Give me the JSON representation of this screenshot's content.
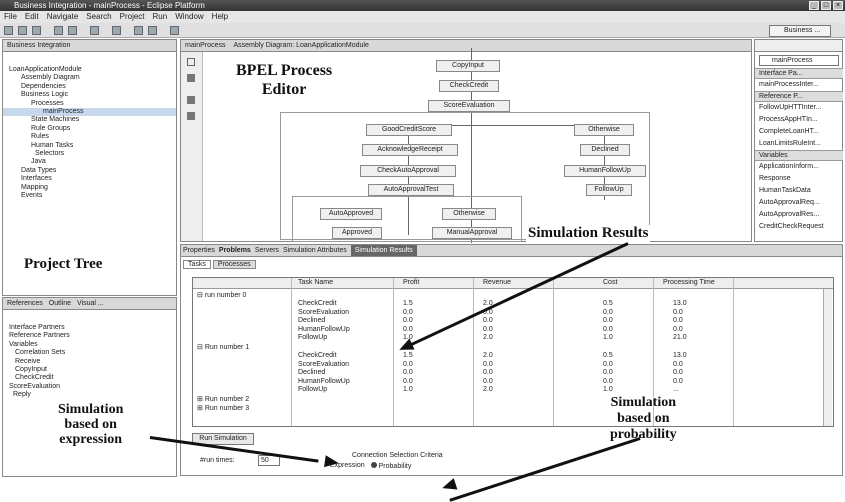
{
  "window": {
    "title": "Business Integration - mainProcess - Eclipse Platform",
    "perspective": "Business ..."
  },
  "menu": [
    "File",
    "Edit",
    "Navigate",
    "Search",
    "Project",
    "Run",
    "Window",
    "Help"
  ],
  "left_top": {
    "tab": "Business Integration",
    "tree": [
      "LoanApplicationModule",
      "Assembly Diagram",
      "Dependencies",
      "Business Logic",
      "Processes",
      "mainProcess",
      "State Machines",
      "Rule Groups",
      "Rules",
      "Human Tasks",
      "Selectors",
      "Java",
      "Data Types",
      "Interfaces",
      "Mapping",
      "Events"
    ]
  },
  "left_bottom": {
    "tabs": [
      "References",
      "Outline",
      "Visual ..."
    ],
    "tree": [
      "Interface Partners",
      "Reference Partners",
      "Variables",
      "Correlation Sets",
      "Receive",
      "CopyInput",
      "CheckCredit",
      "ScoreEvaluation",
      "Reply"
    ]
  },
  "editor": {
    "tabs": [
      "mainProcess",
      "Assembly Diagram: LoanApplicationModule"
    ],
    "nodes": {
      "copy": "CopyInput",
      "check": "CheckCredit",
      "score": "ScoreEvaluation",
      "good": "GoodCreditScore",
      "otherwise1": "Otherwise",
      "ack": "AcknowledgeReceipt",
      "declined": "Declined",
      "checkauto": "CheckAutoApproval",
      "human": "HumanFollowUp",
      "autotest": "AutoApprovalTest",
      "followup": "FollowUp",
      "autoapproved": "AutoApproved",
      "otherwise2": "Otherwise",
      "approved": "Approved",
      "manual": "ManualApproval"
    }
  },
  "right": {
    "tab": "mainProcess",
    "interface_head": "Interface Pa...",
    "interface_items": [
      "mainProcessInter..."
    ],
    "reference_head": "Reference P...",
    "reference_items": [
      "FollowUpHTTInter...",
      "ProcessAppHTIn...",
      "CompleteLoanHT...",
      "LoanLimitsRuleInt..."
    ],
    "variables_head": "Variables",
    "variables_items": [
      "ApplicationInform...",
      "Response",
      "HumanTaskData",
      "AutoApprovalReq...",
      "AutoApprovalRes...",
      "CreditCheckRequest"
    ]
  },
  "bottom": {
    "tabs": [
      "Properties",
      "Problems",
      "Servers",
      "Simulation Attributes",
      "Simulation Results"
    ],
    "subtabs": [
      "Tasks",
      "Processes"
    ],
    "headers": [
      "Task Name",
      "Profit",
      "Revenue",
      "Cost",
      "Processing Time"
    ],
    "groups": [
      {
        "label": "run number 0",
        "rows": [
          [
            "CheckCredit",
            "1.5",
            "2.0",
            "0.5",
            "13.0"
          ],
          [
            "ScoreEvaluation",
            "0.0",
            "0.0",
            "0.0",
            "0.0"
          ],
          [
            "Declined",
            "0.0",
            "0.0",
            "0.0",
            "0.0"
          ],
          [
            "HumanFollowUp",
            "0.0",
            "0.0",
            "0.0",
            "0.0"
          ],
          [
            "FollowUp",
            "1.0",
            "2.0",
            "1.0",
            "21.0"
          ]
        ]
      },
      {
        "label": "Run number 1",
        "rows": [
          [
            "CheckCredit",
            "1.5",
            "2.0",
            "0.5",
            "13.0"
          ],
          [
            "ScoreEvaluation",
            "0.0",
            "0.0",
            "0.0",
            "0.0"
          ],
          [
            "Declined",
            "0.0",
            "0.0",
            "0.0",
            "0.0"
          ],
          [
            "HumanFollowUp",
            "0.0",
            "0.0",
            "0.0",
            "0.0"
          ],
          [
            "FollowUp",
            "1.0",
            "2.0",
            "1.0",
            "..."
          ]
        ]
      },
      {
        "label": "Run number 2",
        "rows": []
      },
      {
        "label": "Run number 3",
        "rows": []
      }
    ],
    "run_button": "Run Simulation",
    "run_times_label": "#run times:",
    "run_times_value": "50",
    "criteria_label": "Connection Selection Criteria",
    "expression": "Expression",
    "probability": "Probability"
  },
  "annotations": {
    "bpel": "BPEL Process\nEditor",
    "project_tree": "Project Tree",
    "sim_results": "Simulation Results",
    "sim_expr": "Simulation\nbased on\nexpression",
    "sim_prob": "Simulation\nbased on\nprobability"
  }
}
